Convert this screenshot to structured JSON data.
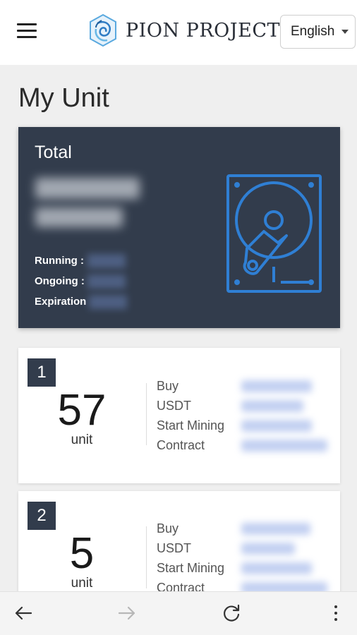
{
  "header": {
    "brand": "PION PROJECT",
    "language": "English",
    "menu_icon": "hamburger-menu-icon",
    "logo_icon": "pion-logo-icon"
  },
  "page": {
    "title": "My Unit"
  },
  "total_card": {
    "title": "Total",
    "running_label": "Running :",
    "ongoing_label": "Ongoing :",
    "expiration_label": "Expiration",
    "icon": "hard-drive-icon"
  },
  "units": [
    {
      "index": "1",
      "count": "57",
      "unit_label": "unit",
      "fields": [
        "Buy",
        "USDT",
        "Start Mining",
        "Contract"
      ]
    },
    {
      "index": "2",
      "count": "5",
      "unit_label": "unit",
      "fields": [
        "Buy",
        "USDT",
        "Start Mining",
        "Contract"
      ]
    }
  ],
  "browser_bar": {
    "back_icon": "arrow-left-icon",
    "forward_icon": "arrow-right-icon",
    "reload_icon": "reload-icon",
    "more_icon": "more-vertical-icon"
  },
  "colors": {
    "card_dark": "#323c4c",
    "accent_blue": "#3d7fd6",
    "page_bg": "#efefef"
  }
}
